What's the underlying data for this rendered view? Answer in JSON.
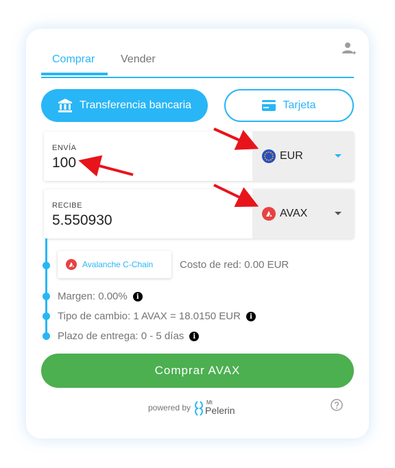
{
  "tabs": {
    "buy": "Comprar",
    "sell": "Vender"
  },
  "payment": {
    "bank_label": "Transferencia bancaria",
    "card_label": "Tarjeta"
  },
  "send": {
    "label": "ENVÍA",
    "value": "100",
    "currency": "EUR"
  },
  "receive": {
    "label": "RECIBE",
    "value": "5.550930",
    "currency": "AVAX"
  },
  "details": {
    "network_chip": "Avalanche C-Chain",
    "network_cost": "Costo de red: 0.00 EUR",
    "margin": "Margen: 0.00%",
    "exchange_rate": "Tipo de cambio: 1 AVAX = 18.0150 EUR",
    "delivery": "Plazo de entrega: 0 - 5 días"
  },
  "cta": {
    "label": "Comprar AVAX"
  },
  "footer": {
    "powered_by": "powered by",
    "brand_top": "Mt",
    "brand_name": "Pelerin"
  },
  "colors": {
    "accent": "#29b6f6",
    "buy_button": "#4caf50",
    "arrow": "#e8141b",
    "avax_red": "#e84142",
    "eur_blue": "#2a4ec0"
  },
  "icons": {
    "user": "user-switch-icon",
    "bank": "bank-icon",
    "card": "credit-card-icon",
    "eur": "eu-flag-icon",
    "avax": "avax-logo-icon",
    "info": "info-icon",
    "help": "help-circle-icon"
  }
}
